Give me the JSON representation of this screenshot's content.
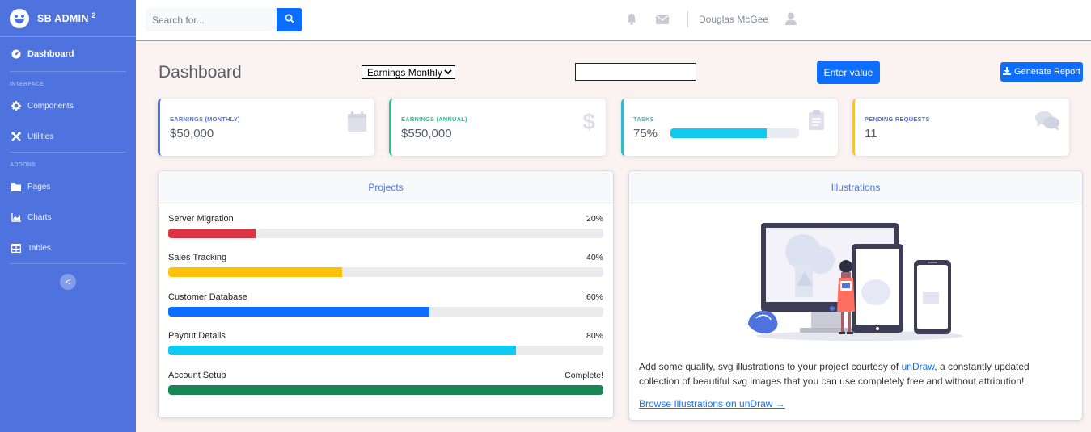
{
  "sidebar": {
    "brand": "SB ADMIN",
    "brand_sup": "2",
    "dashboard": "Dashboard",
    "heading_interface": "INTERFACE",
    "components": "Components",
    "utilities": "Utilities",
    "heading_addons": "ADDONS",
    "pages": "Pages",
    "charts": "Charts",
    "tables": "Tables",
    "toggle": "<"
  },
  "topbar": {
    "search_placeholder": "Search for...",
    "user_name": "Douglas McGee"
  },
  "header": {
    "title": "Dashboard",
    "select_value": "Earnings Monthly",
    "enter_button": "Enter value",
    "report_button": "Generate Report"
  },
  "cards": [
    {
      "label": "EARNINGS (MONTHLY)",
      "value": "$50,000",
      "color": "#4e73df",
      "icon": "calendar-icon"
    },
    {
      "label": "EARNINGS (ANNUAL)",
      "value": "$550,000",
      "color": "#1cc88a",
      "icon": "dollar-icon"
    },
    {
      "label": "TASKS",
      "value": "75%",
      "color": "#36b9cc",
      "icon": "clipboard-icon",
      "progress": 75
    },
    {
      "label": "PENDING REQUESTS",
      "value": "11",
      "color": "#f6c23e",
      "icon": "comments-icon"
    }
  ],
  "projects": {
    "title": "Projects",
    "items": [
      {
        "name": "Server Migration",
        "pct_label": "20%",
        "progress": 20,
        "color": "#dc3545"
      },
      {
        "name": "Sales Tracking",
        "pct_label": "40%",
        "progress": 40,
        "color": "#ffc107"
      },
      {
        "name": "Customer Database",
        "pct_label": "60%",
        "progress": 60,
        "color": "#0d6efd"
      },
      {
        "name": "Payout Details",
        "pct_label": "80%",
        "progress": 80,
        "color": "#0dcaf0"
      },
      {
        "name": "Account Setup",
        "pct_label": "Complete!",
        "progress": 100,
        "color": "#198754"
      }
    ]
  },
  "illustrations": {
    "title": "Illustrations",
    "text_before": "Add some quality, svg illustrations to your project courtesy of ",
    "link": "unDraw",
    "text_after": ", a constantly updated collection of beautiful svg images that you can use completely free and without attribution!",
    "browse": "Browse Illustrations on unDraw →"
  }
}
